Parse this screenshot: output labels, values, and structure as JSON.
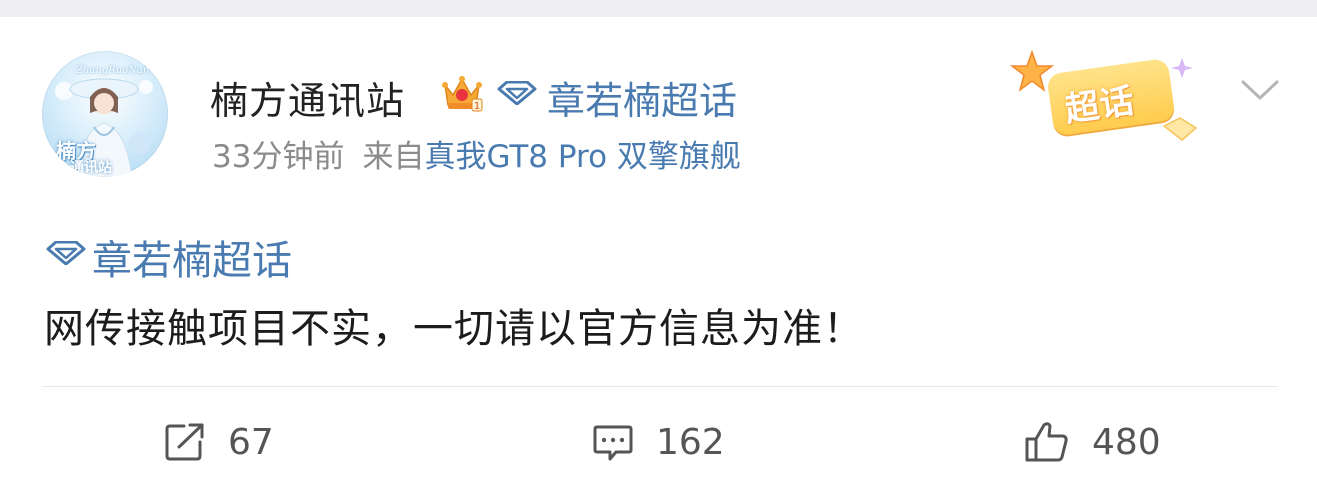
{
  "post": {
    "author_name": "楠方通讯站",
    "avatar_text_top": "ZhangRuoNan",
    "avatar_text_main": "楠方",
    "avatar_text_sub": "通讯站",
    "header_topic": "章若楠超话",
    "time_ago": "33分钟前",
    "from_label": "来自",
    "device": "真我GT8 Pro 双擎旗舰",
    "badge_label": "超话",
    "topic_tag": "章若楠超话",
    "content": "网传接触项目不实，一切请以官方信息为准！"
  },
  "actions": {
    "repost_count": "67",
    "comment_count": "162",
    "like_count": "480"
  },
  "colors": {
    "link_blue": "#4a7bb0",
    "meta_gray": "#8b8b8b",
    "badge_yellow": "#ffcc4d"
  },
  "icons": [
    "crown-icon",
    "diamond-icon",
    "chevron-down-icon",
    "repost-icon",
    "comment-icon",
    "like-icon"
  ]
}
